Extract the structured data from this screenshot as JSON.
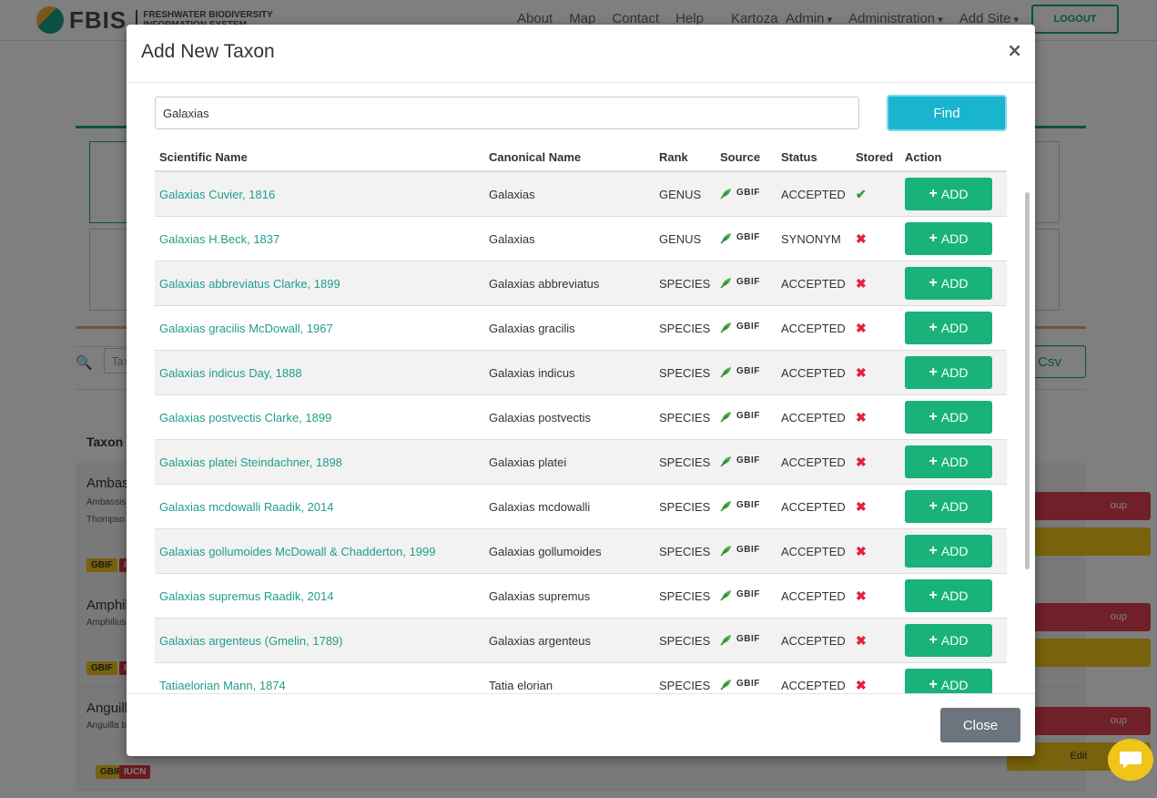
{
  "navbar": {
    "logo_text": "FBIS",
    "logo_sub_1": "FRESHWATER BIODIVERSITY",
    "logo_sub_2": "INFORMATION SYSTEM",
    "links": [
      "About",
      "Map",
      "Contact",
      "Help"
    ],
    "user_menu": "Kartoza_Admin",
    "admin_menu": "Administration",
    "add_site_menu": "Add Site",
    "logout": "LOGOUT"
  },
  "background": {
    "search_placeholder": "Taxo",
    "csv_button": "s Csv",
    "taxon_header": "Taxon N",
    "rows": [
      {
        "title": "Ambas",
        "line1": "Ambassis",
        "line2": "Thompso",
        "btn": "oup",
        "btn2": ""
      },
      {
        "title": "Amphil",
        "line1": "Amphilius",
        "line2": "",
        "btn": "oup",
        "btn2": ""
      },
      {
        "title": "Anguill",
        "line1": "Anguilla b",
        "line2": "",
        "btn": "oup",
        "btn2": "Edit"
      }
    ],
    "badge_gbif": "GBIF",
    "badge_iucn": "IUCN"
  },
  "modal": {
    "title": "Add New Taxon",
    "close_x": "×",
    "search_value": "Galaxias",
    "find_label": "Find",
    "close_label": "Close",
    "columns": [
      "Scientific Name",
      "Canonical Name",
      "Rank",
      "Source",
      "Status",
      "Stored",
      "Action"
    ],
    "source_label": "GBIF",
    "add_label": "ADD",
    "rows": [
      {
        "scientific": "Galaxias Cuvier, 1816",
        "canonical": "Galaxias",
        "rank": "GENUS",
        "status": "ACCEPTED",
        "stored": true
      },
      {
        "scientific": "Galaxias H.Beck, 1837",
        "canonical": "Galaxias",
        "rank": "GENUS",
        "status": "SYNONYM",
        "stored": false
      },
      {
        "scientific": "Galaxias abbreviatus Clarke, 1899",
        "canonical": "Galaxias abbreviatus",
        "rank": "SPECIES",
        "status": "ACCEPTED",
        "stored": false
      },
      {
        "scientific": "Galaxias gracilis McDowall, 1967",
        "canonical": "Galaxias gracilis",
        "rank": "SPECIES",
        "status": "ACCEPTED",
        "stored": false
      },
      {
        "scientific": "Galaxias indicus Day, 1888",
        "canonical": "Galaxias indicus",
        "rank": "SPECIES",
        "status": "ACCEPTED",
        "stored": false
      },
      {
        "scientific": "Galaxias postvectis Clarke, 1899",
        "canonical": "Galaxias postvectis",
        "rank": "SPECIES",
        "status": "ACCEPTED",
        "stored": false
      },
      {
        "scientific": "Galaxias platei Steindachner, 1898",
        "canonical": "Galaxias platei",
        "rank": "SPECIES",
        "status": "ACCEPTED",
        "stored": false
      },
      {
        "scientific": "Galaxias mcdowalli Raadik, 2014",
        "canonical": "Galaxias mcdowalli",
        "rank": "SPECIES",
        "status": "ACCEPTED",
        "stored": false
      },
      {
        "scientific": "Galaxias gollumoides McDowall & Chadderton, 1999",
        "canonical": "Galaxias gollumoides",
        "rank": "SPECIES",
        "status": "ACCEPTED",
        "stored": false
      },
      {
        "scientific": "Galaxias supremus Raadik, 2014",
        "canonical": "Galaxias supremus",
        "rank": "SPECIES",
        "status": "ACCEPTED",
        "stored": false
      },
      {
        "scientific": "Galaxias argenteus (Gmelin, 1789)",
        "canonical": "Galaxias argenteus",
        "rank": "SPECIES",
        "status": "ACCEPTED",
        "stored": false
      },
      {
        "scientific": "Tatiaelorian Mann, 1874",
        "canonical": "Tatia elorian",
        "rank": "SPECIES",
        "status": "ACCEPTED",
        "stored": false
      }
    ]
  },
  "colors": {
    "teal": "#1f9e8a",
    "add_green": "#19b27b",
    "find_blue": "#18b4d0",
    "check_green": "#2b9b3a",
    "cross_red": "#e0243a"
  }
}
